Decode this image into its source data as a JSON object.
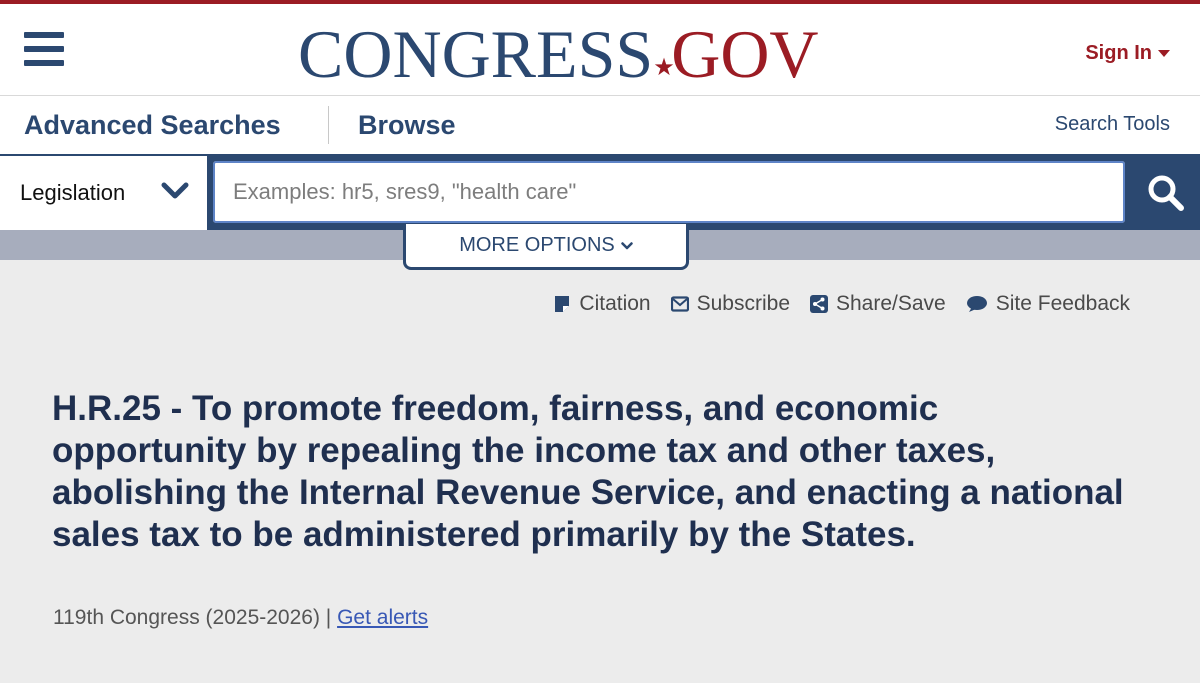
{
  "header": {
    "logo_left": "CONGRESS",
    "logo_right": "GOV",
    "sign_in": "Sign In",
    "colors": {
      "navy": "#2b4870",
      "red": "#9b1c24"
    }
  },
  "nav": {
    "advanced_searches": "Advanced Searches",
    "browse": "Browse",
    "search_tools": "Search Tools"
  },
  "search": {
    "collection": "Legislation",
    "placeholder": "Examples: hr5, sres9, \"health care\"",
    "more_options": "MORE OPTIONS"
  },
  "utilities": [
    {
      "label": "Citation",
      "icon": "citation-icon"
    },
    {
      "label": "Subscribe",
      "icon": "envelope-icon"
    },
    {
      "label": "Share/Save",
      "icon": "share-icon"
    },
    {
      "label": "Site Feedback",
      "icon": "chat-bubble-icon"
    }
  ],
  "bill": {
    "title": "H.R.25 - To promote freedom, fairness, and economic opportunity by repealing the income tax and other taxes, abolishing the Internal Revenue Service, and enacting a national sales tax to be administered primarily by the States.",
    "congress": "119th Congress (2025-2026) | ",
    "alerts_link": "Get alerts"
  }
}
